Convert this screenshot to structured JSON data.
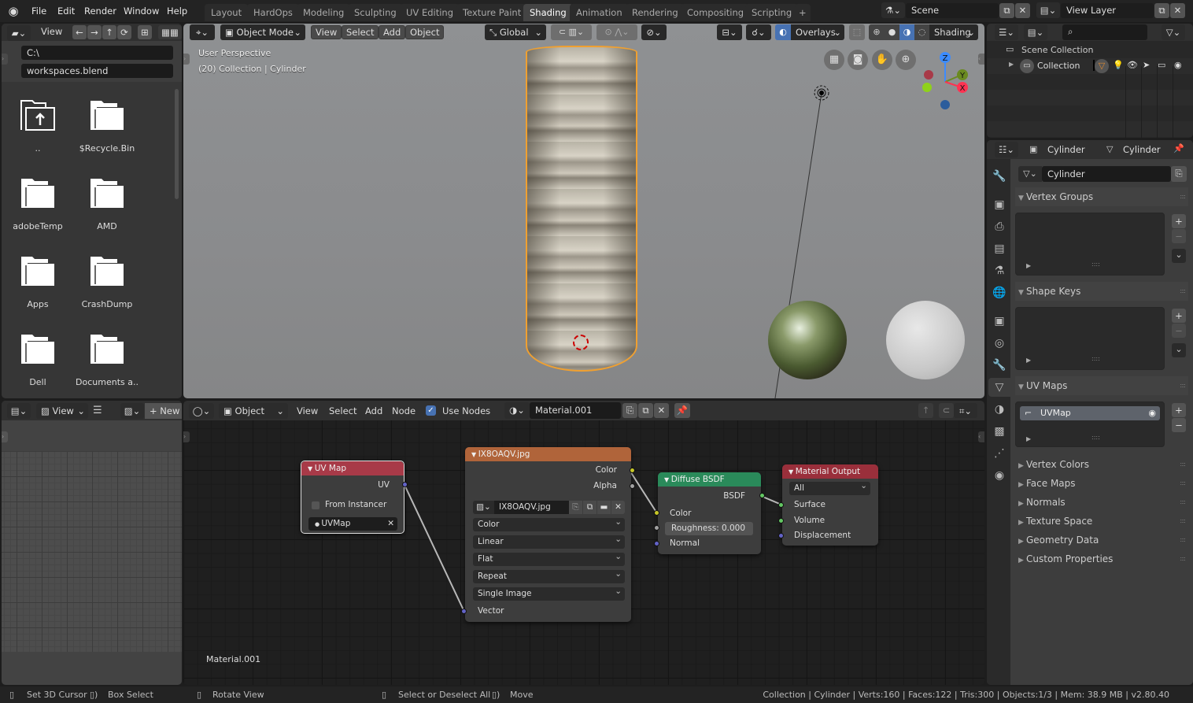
{
  "app": {
    "menu": [
      "File",
      "Edit",
      "Render",
      "Window",
      "Help"
    ],
    "workspace_tabs": [
      "Layout",
      "HardOps",
      "Modeling",
      "Sculpting",
      "UV Editing",
      "Texture Paint",
      "Shading",
      "Animation",
      "Rendering",
      "Compositing",
      "Scripting"
    ],
    "active_tab": "Shading",
    "add_tab_icon": "+",
    "scene": "Scene",
    "view_layer": "View Layer"
  },
  "file_browser": {
    "view_label": "View",
    "path": "C:\\",
    "filename": "workspaces.blend",
    "items": [
      {
        "name": "..",
        "icon": "parent-folder-icon"
      },
      {
        "name": "$Recycle.Bin",
        "icon": "folder-icon"
      },
      {
        "name": "adobeTemp",
        "icon": "folder-icon"
      },
      {
        "name": "AMD",
        "icon": "folder-icon"
      },
      {
        "name": "Apps",
        "icon": "folder-icon"
      },
      {
        "name": "CrashDump",
        "icon": "folder-icon"
      },
      {
        "name": "Dell",
        "icon": "folder-icon"
      },
      {
        "name": "Documents a..",
        "icon": "folder-icon"
      }
    ]
  },
  "viewport": {
    "mode": "Object Mode",
    "menus": [
      "View",
      "Select",
      "Add",
      "Object"
    ],
    "transform_orientation": "Global",
    "overlays_label": "Overlays",
    "shading_label": "Shading",
    "perspective_label": "User Perspective",
    "collection_label": "(20) Collection | Cylinder",
    "gizmo_axes": {
      "x": "X",
      "y": "Y",
      "z": "Z"
    }
  },
  "outliner": {
    "scene_collection": "Scene Collection",
    "collection": "Collection"
  },
  "properties": {
    "breadcrumb_object": "Cylinder",
    "breadcrumb_mesh": "Cylinder",
    "mesh_name": "Cylinder",
    "panels": [
      {
        "label": "Vertex Groups",
        "open": true
      },
      {
        "label": "Shape Keys",
        "open": true
      },
      {
        "label": "UV Maps",
        "open": true
      },
      {
        "label": "Vertex Colors",
        "open": false
      },
      {
        "label": "Face Maps",
        "open": false
      },
      {
        "label": "Normals",
        "open": false
      },
      {
        "label": "Texture Space",
        "open": false
      },
      {
        "label": "Geometry Data",
        "open": false
      },
      {
        "label": "Custom Properties",
        "open": false
      }
    ],
    "uv_map_item": "UVMap"
  },
  "image_editor": {
    "view_label": "View",
    "new_label": "New"
  },
  "node_editor": {
    "object_type": "Object",
    "menus": [
      "View",
      "Select",
      "Add",
      "Node"
    ],
    "use_nodes_label": "Use Nodes",
    "use_nodes_checked": true,
    "material_name": "Material.001",
    "material_overlay_label": "Material.001",
    "nodes": {
      "uvmap": {
        "title": "UV Map",
        "output": "UV",
        "from_instancer": "From Instancer",
        "uv_value": "UVMap",
        "color": "#a83a48"
      },
      "image": {
        "title": "IX8OAQV.jpg",
        "outputs": [
          "Color",
          "Alpha"
        ],
        "image_name": "IX8OAQV.jpg",
        "dropdowns": [
          "Color",
          "Linear",
          "Flat",
          "Repeat",
          "Single Image"
        ],
        "input": "Vector",
        "color": "#b0643a"
      },
      "diffuse": {
        "title": "Diffuse BSDF",
        "output": "BSDF",
        "inputs": [
          "Color",
          "Normal"
        ],
        "roughness_label": "Roughness:",
        "roughness_value": "0.000",
        "color": "#2a8a5a"
      },
      "output": {
        "title": "Material Output",
        "target": "All",
        "inputs": [
          "Surface",
          "Volume",
          "Displacement"
        ],
        "color": "#9a2f3b"
      }
    }
  },
  "status_bar": {
    "hints": [
      "Set 3D Cursor",
      "Box Select",
      "Rotate View",
      "Select or Deselect All",
      "Move"
    ],
    "stats": "Collection | Cylinder | Verts:160 | Faces:122 | Tris:300 | Objects:1/3 | Mem: 38.9 MB | v2.80.40"
  },
  "colors": {
    "selection_outline": "#f0a030",
    "accent_blue": "#4772b3"
  }
}
